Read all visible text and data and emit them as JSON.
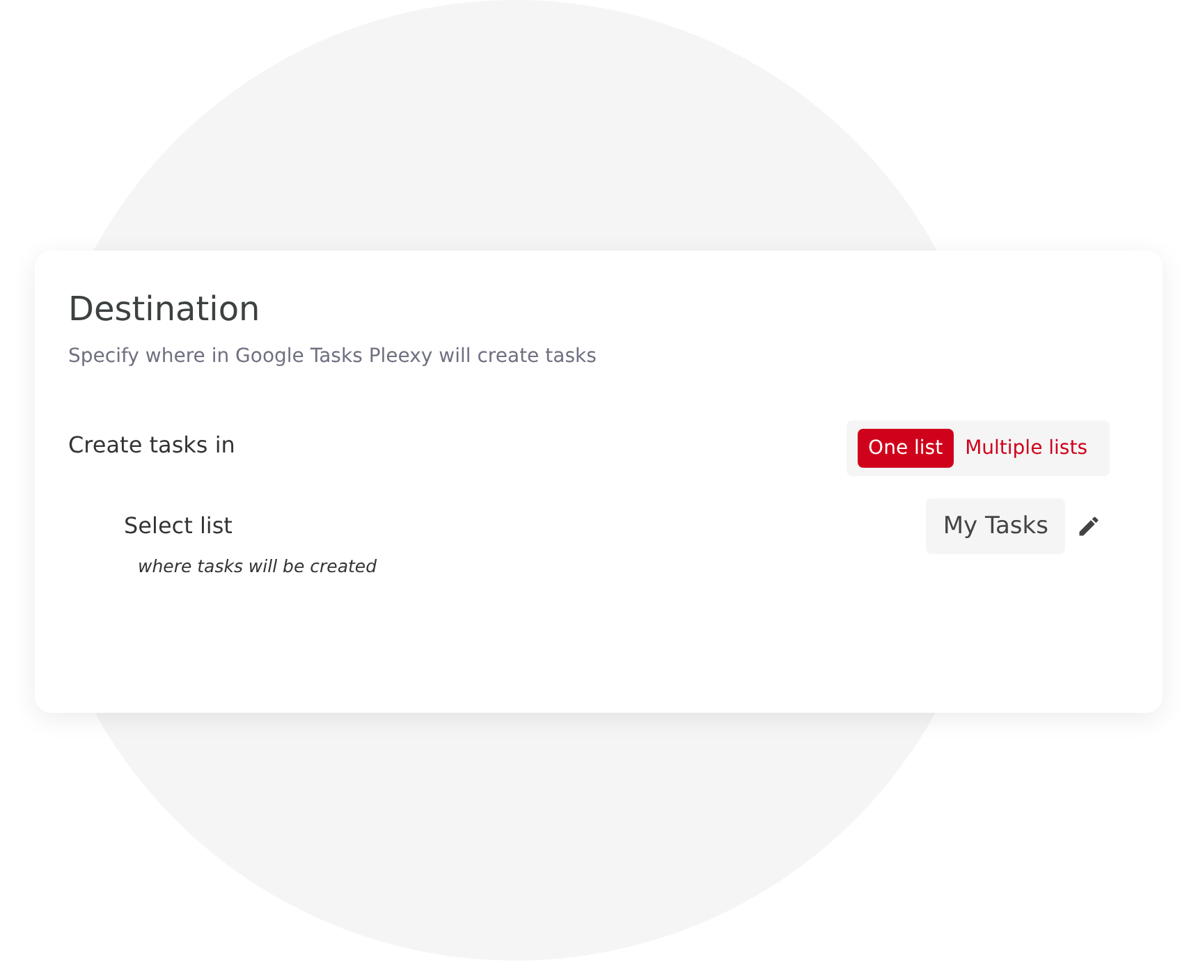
{
  "card": {
    "title": "Destination",
    "subtitle": "Specify where in Google Tasks Pleexy will create tasks",
    "create_tasks": {
      "label": "Create tasks in",
      "options": [
        {
          "label": "One list",
          "selected": true
        },
        {
          "label": "Multiple lists",
          "selected": false
        }
      ]
    },
    "select_list": {
      "label": "Select list",
      "hint": "where tasks will be created",
      "value": "My Tasks"
    }
  }
}
